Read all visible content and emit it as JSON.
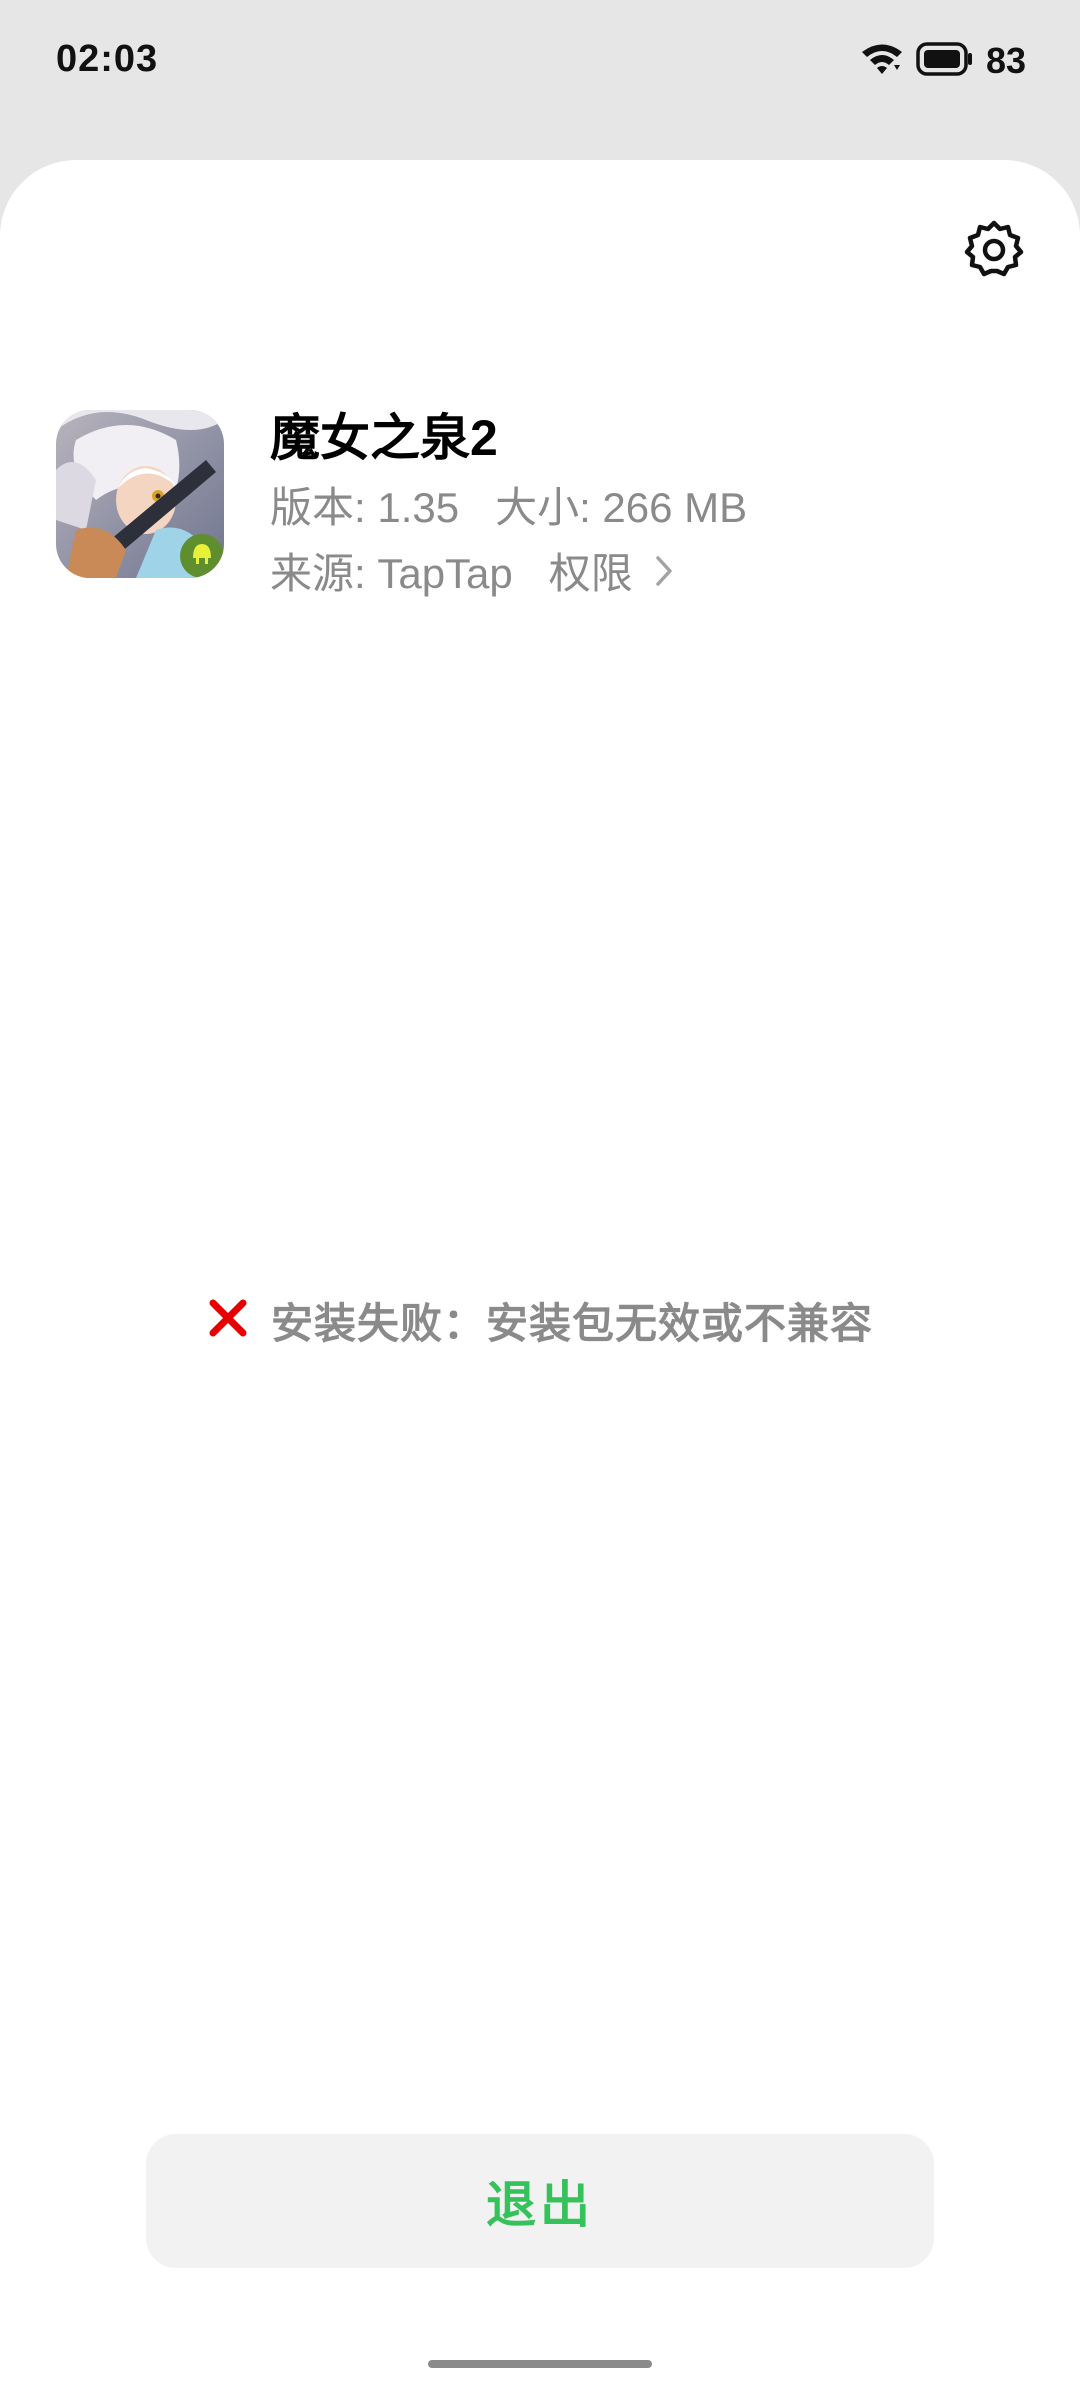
{
  "status_bar": {
    "time": "02:03",
    "battery_level": "83",
    "icons": [
      "wifi-icon",
      "battery-icon"
    ]
  },
  "header": {
    "settings_icon": "gear-icon"
  },
  "app": {
    "name": "魔女之泉2",
    "version_label": "版本: 1.35",
    "size_label": "大小: 266 MB",
    "source_label": "来源: TapTap",
    "permissions_label": "权限"
  },
  "result": {
    "icon": "close-icon",
    "icon_color": "#e60000",
    "message": "安装失败：安装包无效或不兼容"
  },
  "actions": {
    "exit_label": "退出",
    "exit_color": "#35c25a"
  }
}
